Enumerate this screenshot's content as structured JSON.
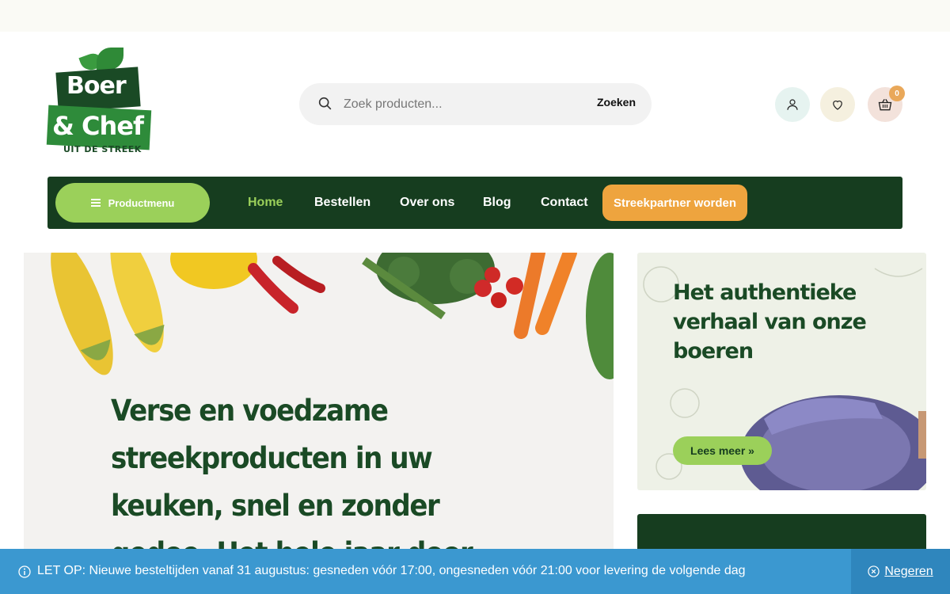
{
  "logo": {
    "line1": "Boer",
    "line2": "& Chef",
    "line3": "UIT DE STREEK"
  },
  "search": {
    "placeholder": "Zoek producten...",
    "button_label": "Zoeken",
    "icon": "search-icon"
  },
  "header_icons": {
    "account": "user-icon",
    "wishlist": "heart-icon",
    "cart": "basket-icon",
    "cart_count": "0"
  },
  "nav": {
    "product_menu_label": "Productmenu",
    "items": [
      {
        "label": "Home",
        "active": true
      },
      {
        "label": "Bestellen"
      },
      {
        "label": "Over ons"
      },
      {
        "label": "Blog"
      },
      {
        "label": "Contact"
      }
    ],
    "cta_label": "Streekpartner worden"
  },
  "hero": {
    "title": "Verse en voedzame streekproducten in uw keuken, snel en zonder gedoe. Het hele jaar door"
  },
  "side_card": {
    "title": "Het authentieke verhaal van onze boeren",
    "button_label": "Lees meer »"
  },
  "notice": {
    "text": "LET OP: Nieuwe besteltijden vanaf 31 augustus: gesneden vóór 17:00, ongesneden vóór 21:00 voor levering de volgende dag",
    "dismiss_label": "Negeren"
  },
  "colors": {
    "dark_green": "#163d1f",
    "light_green": "#9bd05a",
    "orange": "#eea43e",
    "notice_blue": "#3b98d0"
  }
}
